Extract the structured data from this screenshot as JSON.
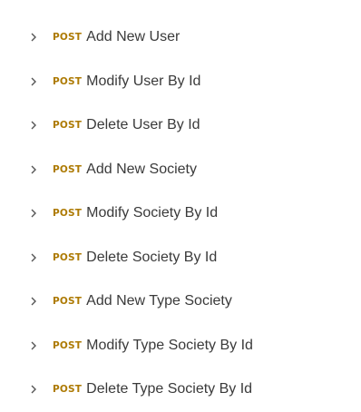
{
  "colors": {
    "method_post": "#ad7a03",
    "text": "#3a3a3a",
    "chevron": "#555555"
  },
  "requests": [
    {
      "method": "POST",
      "name": "Add New User",
      "icon": "chevron-right-icon"
    },
    {
      "method": "POST",
      "name": "Modify User By Id",
      "icon": "chevron-right-icon"
    },
    {
      "method": "POST",
      "name": "Delete User By Id",
      "icon": "chevron-right-icon"
    },
    {
      "method": "POST",
      "name": "Add New Society",
      "icon": "chevron-right-icon"
    },
    {
      "method": "POST",
      "name": "Modify Society By Id",
      "icon": "chevron-right-icon"
    },
    {
      "method": "POST",
      "name": "Delete Society By Id",
      "icon": "chevron-right-icon"
    },
    {
      "method": "POST",
      "name": "Add New Type Society",
      "icon": "chevron-right-icon"
    },
    {
      "method": "POST",
      "name": "Modify Type Society By Id",
      "icon": "chevron-right-icon"
    },
    {
      "method": "POST",
      "name": "Delete Type Society By Id",
      "icon": "chevron-right-icon"
    }
  ]
}
